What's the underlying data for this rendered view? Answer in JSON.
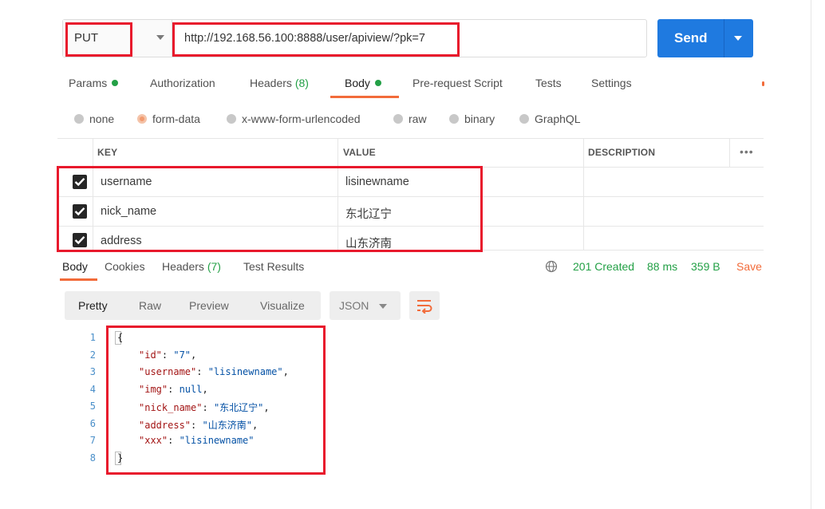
{
  "request": {
    "method": "PUT",
    "url": "http://192.168.56.100:8888/user/apiview/?pk=7",
    "send_label": "Send"
  },
  "request_tabs": [
    {
      "label": "Params",
      "dot": true
    },
    {
      "label": "Authorization"
    },
    {
      "label": "Headers",
      "count": "(8)"
    },
    {
      "label": "Body",
      "dot": true,
      "active": true
    },
    {
      "label": "Pre-request Script"
    },
    {
      "label": "Tests"
    },
    {
      "label": "Settings"
    }
  ],
  "body_types": [
    {
      "label": "none",
      "selected": false
    },
    {
      "label": "form-data",
      "selected": true
    },
    {
      "label": "x-www-form-urlencoded",
      "selected": false
    },
    {
      "label": "raw",
      "selected": false
    },
    {
      "label": "binary",
      "selected": false
    },
    {
      "label": "GraphQL",
      "selected": false
    }
  ],
  "params_table": {
    "columns": [
      "KEY",
      "VALUE",
      "DESCRIPTION"
    ],
    "more_label": "•••",
    "rows": [
      {
        "checked": true,
        "key": "username",
        "value": "lisinewname"
      },
      {
        "checked": true,
        "key": "nick_name",
        "value": "东北辽宁"
      },
      {
        "checked": true,
        "key": "address",
        "value": "山东济南"
      }
    ]
  },
  "response_tabs": [
    {
      "label": "Body",
      "active": true
    },
    {
      "label": "Cookies"
    },
    {
      "label": "Headers",
      "count": "(7)"
    },
    {
      "label": "Test Results"
    }
  ],
  "response_status": {
    "status": "201 Created",
    "time": "88 ms",
    "size": "359 B",
    "save_label": "Save"
  },
  "response_view": {
    "options": [
      "Pretty",
      "Raw",
      "Preview",
      "Visualize"
    ],
    "active": "Pretty",
    "format": "JSON"
  },
  "response_code": {
    "line_numbers": [
      "1",
      "2",
      "3",
      "4",
      "5",
      "6",
      "7",
      "8"
    ],
    "open_brace": "{",
    "close_brace": "}",
    "fields": [
      {
        "key": "\"id\"",
        "value": "\"7\"",
        "comma": ","
      },
      {
        "key": "\"username\"",
        "value": "\"lisinewname\"",
        "comma": ","
      },
      {
        "key": "\"img\"",
        "value": "null",
        "comma": ","
      },
      {
        "key": "\"nick_name\"",
        "value": "\"东北辽宁\"",
        "comma": ","
      },
      {
        "key": "\"address\"",
        "value": "\"山东济南\"",
        "comma": ","
      },
      {
        "key": "\"xxx\"",
        "value": "\"lisinewname\"",
        "comma": ""
      }
    ]
  },
  "colors": {
    "accent": "#f26b3a",
    "send_blue": "#1f7ae0",
    "success_green": "#23a046",
    "annotation_red": "#e8192c"
  }
}
